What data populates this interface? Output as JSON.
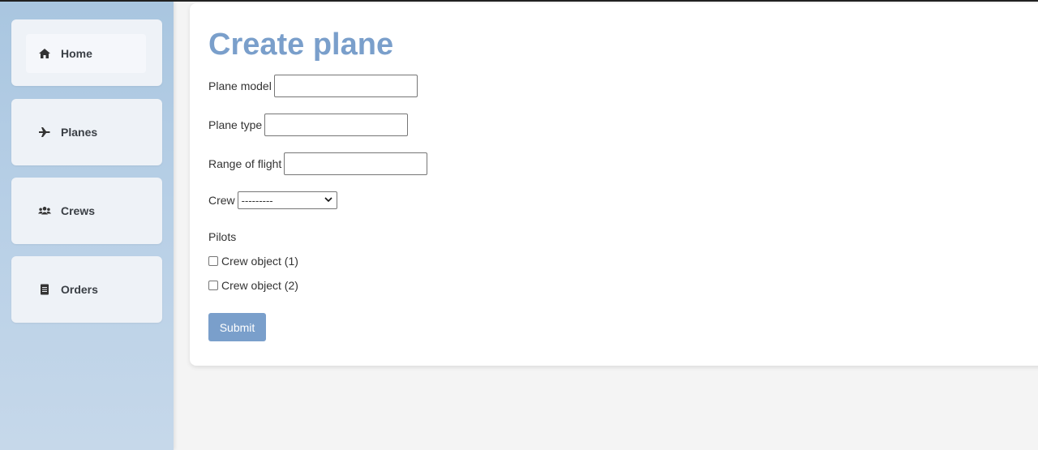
{
  "sidebar": {
    "items": [
      {
        "label": "Home",
        "icon": "home-icon"
      },
      {
        "label": "Planes",
        "icon": "plane-icon"
      },
      {
        "label": "Crews",
        "icon": "users-icon"
      },
      {
        "label": "Orders",
        "icon": "clipboard-icon"
      }
    ]
  },
  "form": {
    "title": "Create plane",
    "plane_model_label": "Plane model",
    "plane_model_value": "",
    "plane_type_label": "Plane type",
    "plane_type_value": "",
    "range_label": "Range of flight",
    "range_value": "",
    "crew_label": "Crew",
    "crew_selected": "---------",
    "pilots_label": "Pilots",
    "pilots_options": [
      "Crew object (1)",
      "Crew object (2)"
    ],
    "submit_label": "Submit"
  },
  "colors": {
    "accent": "#7a9fcb",
    "sidebar": "#b7cfe6"
  }
}
